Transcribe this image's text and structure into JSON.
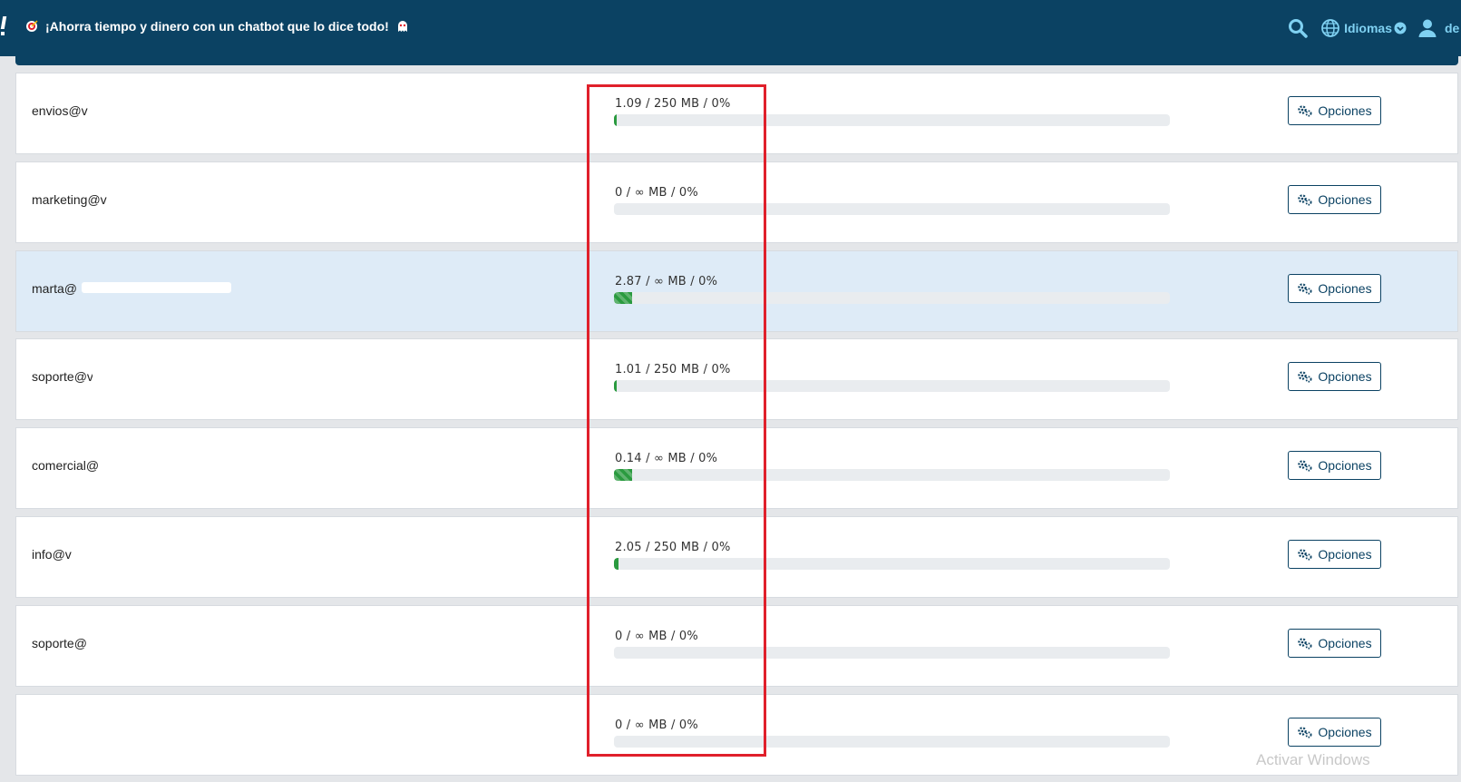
{
  "header": {
    "promo_text": "¡Ahorra tiempo y dinero con un chatbot que lo dice todo!",
    "languages_label": "Idiomas",
    "user_label": "de"
  },
  "colors": {
    "header_bg": "#0b4263",
    "accent": "#7fd1f2",
    "progress_fill": "#2a9a3f",
    "selected_row": "#deebf7",
    "highlight_box": "#e0202b"
  },
  "accounts": [
    {
      "email": "envios@v",
      "usage": "1.09 / 250 MB / 0%",
      "usage_fraction": 0.0044,
      "striped": false,
      "selected": false,
      "option_label": "Opciones"
    },
    {
      "email": "marketing@v",
      "usage": "0 / ∞ MB / 0%",
      "usage_fraction": 0,
      "striped": false,
      "selected": false,
      "option_label": "Opciones"
    },
    {
      "email": "marta@",
      "usage": "2.87 / ∞ MB / 0%",
      "usage_fraction": 0.033,
      "striped": true,
      "selected": true,
      "option_label": "Opciones"
    },
    {
      "email": "soporte@v",
      "usage": "1.01 / 250 MB / 0%",
      "usage_fraction": 0.004,
      "striped": false,
      "selected": false,
      "option_label": "Opciones"
    },
    {
      "email": "comercial@",
      "usage": "0.14 / ∞ MB / 0%",
      "usage_fraction": 0.033,
      "striped": true,
      "selected": false,
      "option_label": "Opciones"
    },
    {
      "email": "info@v",
      "usage": "2.05 / 250 MB / 0%",
      "usage_fraction": 0.0082,
      "striped": false,
      "selected": false,
      "option_label": "Opciones"
    },
    {
      "email": "soporte@",
      "usage": "0 / ∞ MB / 0%",
      "usage_fraction": 0,
      "striped": false,
      "selected": false,
      "option_label": "Opciones"
    },
    {
      "email": "",
      "usage": "0 / ∞ MB / 0%",
      "usage_fraction": 0,
      "striped": false,
      "selected": false,
      "option_label": "Opciones"
    }
  ],
  "watermark": "Activar Windows"
}
